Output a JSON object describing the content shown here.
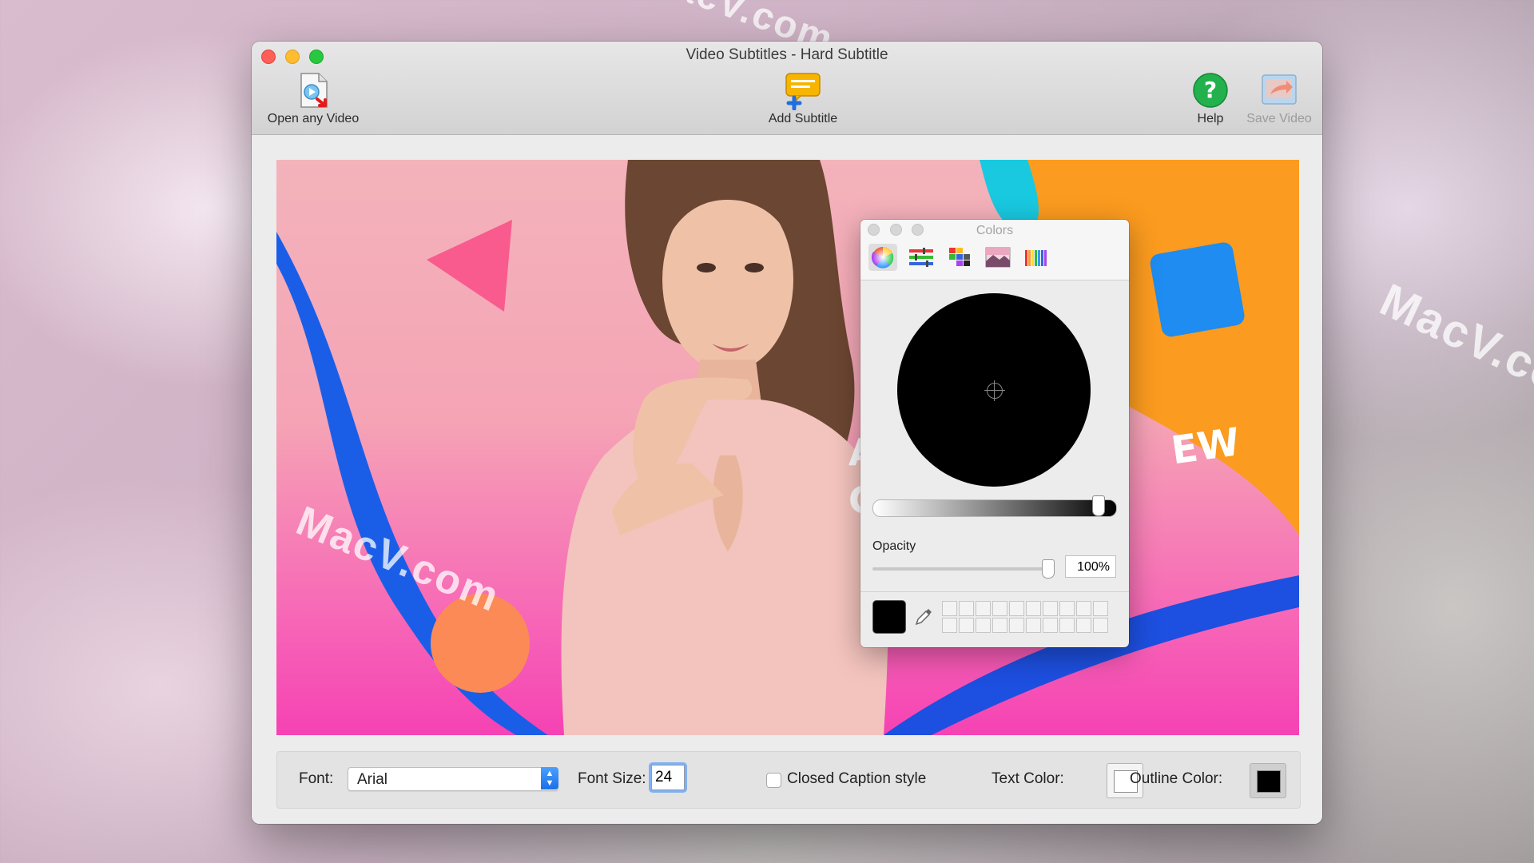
{
  "window": {
    "title": "Video Subtitles - Hard Subtitle"
  },
  "toolbar": {
    "open_label": "Open any Video",
    "add_subtitle_label": "Add Subtitle",
    "help_label": "Help",
    "save_label": "Save Video"
  },
  "bottom_bar": {
    "font_label": "Font:",
    "font_value": "Arial",
    "font_size_label": "Font Size:",
    "font_size_value": "24",
    "closed_caption_label": "Closed Caption style",
    "closed_caption_checked": false,
    "text_color_label": "Text Color:",
    "text_color": "#ffffff",
    "outline_color_label": "Outline Color:",
    "outline_color": "#000000"
  },
  "colors_panel": {
    "title": "Colors",
    "tabs": [
      "color-wheel-icon",
      "sliders-icon",
      "palettes-icon",
      "image-palettes-icon",
      "pencils-icon"
    ],
    "selected_tab": "color-wheel-icon",
    "current_color": "#000000",
    "opacity_label": "Opacity",
    "opacity_value": "100%"
  },
  "video": {
    "overlay_text_right": "EW",
    "overlay_text_left_1": "A",
    "overlay_text_left_2": "C"
  },
  "watermarks": [
    "MacV.com",
    "MacV.com",
    "MacV.co"
  ]
}
